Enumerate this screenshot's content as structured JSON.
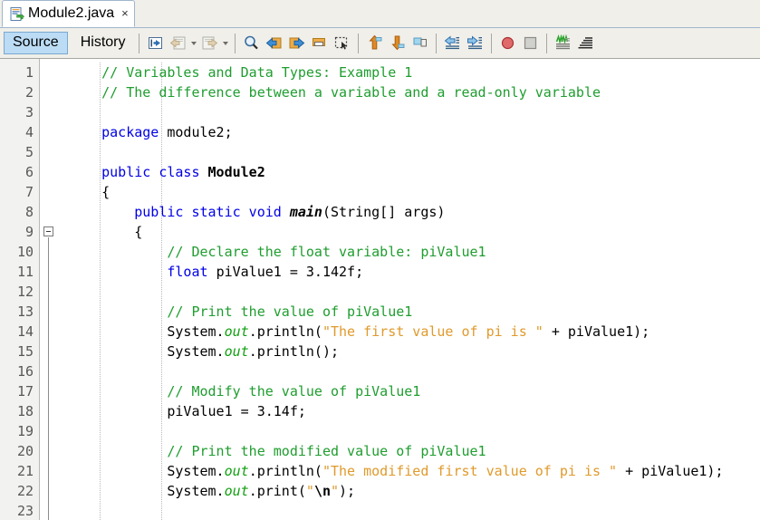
{
  "window": {
    "file_tab": {
      "label": "Module2.java",
      "close_label": "×",
      "icon": "java-file-icon"
    }
  },
  "view_tabs": [
    {
      "label": "Source",
      "selected": true
    },
    {
      "label": "History",
      "selected": false
    }
  ],
  "toolbar": {
    "groups": [
      {
        "name": "navigation-group",
        "buttons": [
          {
            "name": "last-edit-position-button",
            "icon": "last-edit-icon"
          },
          {
            "name": "back-button",
            "icon": "back-arrow-icon",
            "dropdown": true
          },
          {
            "name": "forward-button",
            "icon": "forward-arrow-icon",
            "dropdown": true
          }
        ]
      },
      {
        "name": "find-group",
        "buttons": [
          {
            "name": "find-selection-button",
            "icon": "magnifier-icon"
          },
          {
            "name": "find-previous-button",
            "icon": "find-previous-icon"
          },
          {
            "name": "find-next-button",
            "icon": "find-next-icon"
          },
          {
            "name": "toggle-highlight-button",
            "icon": "highlight-search-icon"
          },
          {
            "name": "toggle-rectangular-selection-button",
            "icon": "rectangular-selection-icon"
          }
        ]
      },
      {
        "name": "bookmark-group",
        "buttons": [
          {
            "name": "previous-bookmark-button",
            "icon": "previous-bookmark-icon"
          },
          {
            "name": "next-bookmark-button",
            "icon": "next-bookmark-icon"
          },
          {
            "name": "toggle-bookmark-button",
            "icon": "toggle-bookmark-icon"
          }
        ]
      },
      {
        "name": "indent-group",
        "buttons": [
          {
            "name": "shift-left-button",
            "icon": "shift-left-icon"
          },
          {
            "name": "shift-right-button",
            "icon": "shift-right-icon"
          }
        ]
      },
      {
        "name": "macro-group",
        "buttons": [
          {
            "name": "start-macro-recording-button",
            "icon": "record-macro-icon"
          },
          {
            "name": "stop-macro-recording-button",
            "icon": "stop-macro-icon"
          }
        ]
      },
      {
        "name": "format-group",
        "buttons": [
          {
            "name": "inspect-button",
            "icon": "inspect-code-icon"
          },
          {
            "name": "format-button",
            "icon": "format-code-icon"
          }
        ]
      }
    ]
  },
  "editor": {
    "first_line_number": 1,
    "last_line_number": 23,
    "fold_marker_line": 9,
    "lines": [
      {
        "n": 1,
        "tokens": [
          {
            "t": "cmt",
            "s": "    // Variables and Data Types: Example 1"
          }
        ]
      },
      {
        "n": 2,
        "tokens": [
          {
            "t": "cmt",
            "s": "    // The difference between a variable and a read-only variable"
          }
        ]
      },
      {
        "n": 3,
        "tokens": []
      },
      {
        "n": 4,
        "tokens": [
          {
            "t": "kw",
            "s": "    package "
          },
          {
            "t": "plain",
            "s": "module2;"
          }
        ]
      },
      {
        "n": 5,
        "tokens": []
      },
      {
        "n": 6,
        "tokens": [
          {
            "t": "kw",
            "s": "    public class "
          },
          {
            "t": "cls",
            "s": "Module2"
          }
        ]
      },
      {
        "n": 7,
        "tokens": [
          {
            "t": "plain",
            "s": "    {"
          }
        ]
      },
      {
        "n": 8,
        "tokens": [
          {
            "t": "kw",
            "s": "        public static void "
          },
          {
            "t": "mth",
            "s": "main"
          },
          {
            "t": "plain",
            "s": "(String[] args)"
          }
        ]
      },
      {
        "n": 9,
        "tokens": [
          {
            "t": "plain",
            "s": "        {"
          }
        ]
      },
      {
        "n": 10,
        "tokens": [
          {
            "t": "cmt",
            "s": "            // Declare the float variable: piValue1"
          }
        ]
      },
      {
        "n": 11,
        "tokens": [
          {
            "t": "kw",
            "s": "            float "
          },
          {
            "t": "plain",
            "s": "piValue1 = 3.142f;"
          }
        ]
      },
      {
        "n": 12,
        "tokens": []
      },
      {
        "n": 13,
        "tokens": [
          {
            "t": "cmt",
            "s": "            // Print the value of piValue1"
          }
        ]
      },
      {
        "n": 14,
        "tokens": [
          {
            "t": "plain",
            "s": "            System."
          },
          {
            "t": "fld",
            "s": "out"
          },
          {
            "t": "plain",
            "s": ".println("
          },
          {
            "t": "str",
            "s": "\"The first value of pi is \""
          },
          {
            "t": "plain",
            "s": " + piValue1);"
          }
        ]
      },
      {
        "n": 15,
        "tokens": [
          {
            "t": "plain",
            "s": "            System."
          },
          {
            "t": "fld",
            "s": "out"
          },
          {
            "t": "plain",
            "s": ".println();"
          }
        ]
      },
      {
        "n": 16,
        "tokens": []
      },
      {
        "n": 17,
        "tokens": [
          {
            "t": "cmt",
            "s": "            // Modify the value of piValue1"
          }
        ]
      },
      {
        "n": 18,
        "tokens": [
          {
            "t": "plain",
            "s": "            piValue1 = 3.14f;"
          }
        ]
      },
      {
        "n": 19,
        "tokens": []
      },
      {
        "n": 20,
        "tokens": [
          {
            "t": "cmt",
            "s": "            // Print the modified value of piValue1"
          }
        ]
      },
      {
        "n": 21,
        "tokens": [
          {
            "t": "plain",
            "s": "            System."
          },
          {
            "t": "fld",
            "s": "out"
          },
          {
            "t": "plain",
            "s": ".println("
          },
          {
            "t": "str",
            "s": "\"The modified first value of pi is \""
          },
          {
            "t": "plain",
            "s": " + piValue1);"
          }
        ]
      },
      {
        "n": 22,
        "tokens": [
          {
            "t": "plain",
            "s": "            System."
          },
          {
            "t": "fld",
            "s": "out"
          },
          {
            "t": "plain",
            "s": ".print("
          },
          {
            "t": "str",
            "s": "\""
          },
          {
            "t": "esc",
            "s": "\\n"
          },
          {
            "t": "str",
            "s": "\""
          },
          {
            "t": "plain",
            "s": ");"
          }
        ]
      },
      {
        "n": 23,
        "tokens": []
      }
    ]
  },
  "colors": {
    "comment": "#1f9d2f",
    "keyword": "#0000e6",
    "string": "#e09a2c",
    "field": "#11a011",
    "selected_tab_bg": "#bcdcf5",
    "gutter_bg": "#f2f2f0",
    "chrome_bg": "#f0efe9"
  }
}
